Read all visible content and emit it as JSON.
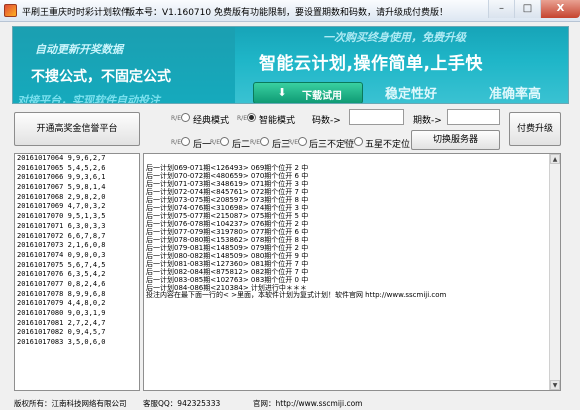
{
  "window": {
    "title": "平刷王重庆时时彩计划软件",
    "version": "版本号：V1.160710",
    "notice": "免费版有功能限制，要设置期数和码数，请升级成付费版！",
    "controls": [
      "–",
      "□",
      "X"
    ]
  },
  "banner": {
    "left_top": "自动更新开奖数据",
    "left_mid": "不搜公式，不固定公式",
    "left_bottom": "对接平台，实现软件自动投注",
    "right_top": "一次购买终身使用，免费升级",
    "right_mid": "智能云计划,操作简单,上手快",
    "right_bottom_1": "稳定性好",
    "right_bottom_2": "准确率高",
    "download_label": "下载试用",
    "download_icon": "download-arrow"
  },
  "toolbar": {
    "platform_button": "开通高奖金信誉平台",
    "option_tag": "R/E",
    "radios": [
      {
        "label": "经典模式",
        "checked": false
      },
      {
        "label": "智能模式",
        "checked": true
      },
      {
        "label": "后一",
        "checked": false
      },
      {
        "label": "后二",
        "checked": false
      },
      {
        "label": "后三",
        "checked": false
      },
      {
        "label": "后三不定位",
        "checked": false
      },
      {
        "label": "五星不定位",
        "checked": false
      }
    ],
    "code_label": "码数->",
    "period_label": "期数->",
    "code_value": "",
    "period_value": "",
    "switch_server": "切换服务器",
    "upgrade": "付费升级"
  },
  "draws": [
    "20161017064 9,9,6,2,7",
    "20161017065 5,4,5,2,6",
    "20161017066 9,9,3,6,1",
    "20161017067 5,9,8,1,4",
    "20161017068 2,9,8,2,0",
    "20161017069 4,7,0,3,2",
    "20161017070 9,5,1,3,5",
    "20161017071 6,3,0,3,3",
    "20161017072 6,6,7,8,7",
    "20161017073 2,1,6,0,8",
    "20161017074 0,9,0,0,3",
    "20161017075 5,6,7,4,5",
    "20161017076 6,3,5,4,2",
    "20161017077 0,8,2,4,6",
    "20161017078 8,9,9,6,8",
    "20161017079 4,4,8,0,2",
    "20161017080 9,0,3,1,9",
    "20161017081 2,7,2,4,7",
    "20161017082 0,9,4,5,7",
    "20161017083 3,5,0,6,0"
  ],
  "log": [
    "后一计划069-071期<126493> 069期个位开 2  中",
    "后一计划070-072期<480659> 070期个位开 6  中",
    "后一计划071-073期<348619> 071期个位开 3  中",
    "后一计划072-074期<845761> 072期个位开 7  中",
    "后一计划073-075期<208597> 073期个位开 8  中",
    "后一计划074-076期<310698> 074期个位开 3  中",
    "后一计划075-077期<215087> 075期个位开 5  中",
    "后一计划076-078期<104237> 076期个位开 2  中",
    "后一计划077-079期<319780> 077期个位开 6  中",
    "后一计划078-080期<153862> 078期个位开 8  中",
    "后一计划079-081期<148509> 079期个位开 2  中",
    "后一计划080-082期<148509> 080期个位开 9  中",
    "后一计划081-083期<127360> 081期个位开 7  中",
    "后一计划082-084期<875812> 082期个位开 7  中",
    "后一计划083-085期<102763> 083期个位开 0  中",
    "后一计划084-086期<210384> 计划进行中＊＊＊"
  ],
  "log_message": "投注内容在最下面一行的< >里面，本软件计划为复式计划！软件官网    http://www.sscmiji.com",
  "status": {
    "copyright": "版权所有：江南科技网络有限公司",
    "support": "客服QQ：942325333",
    "website": "官网：http://www.sscmiji.com"
  }
}
